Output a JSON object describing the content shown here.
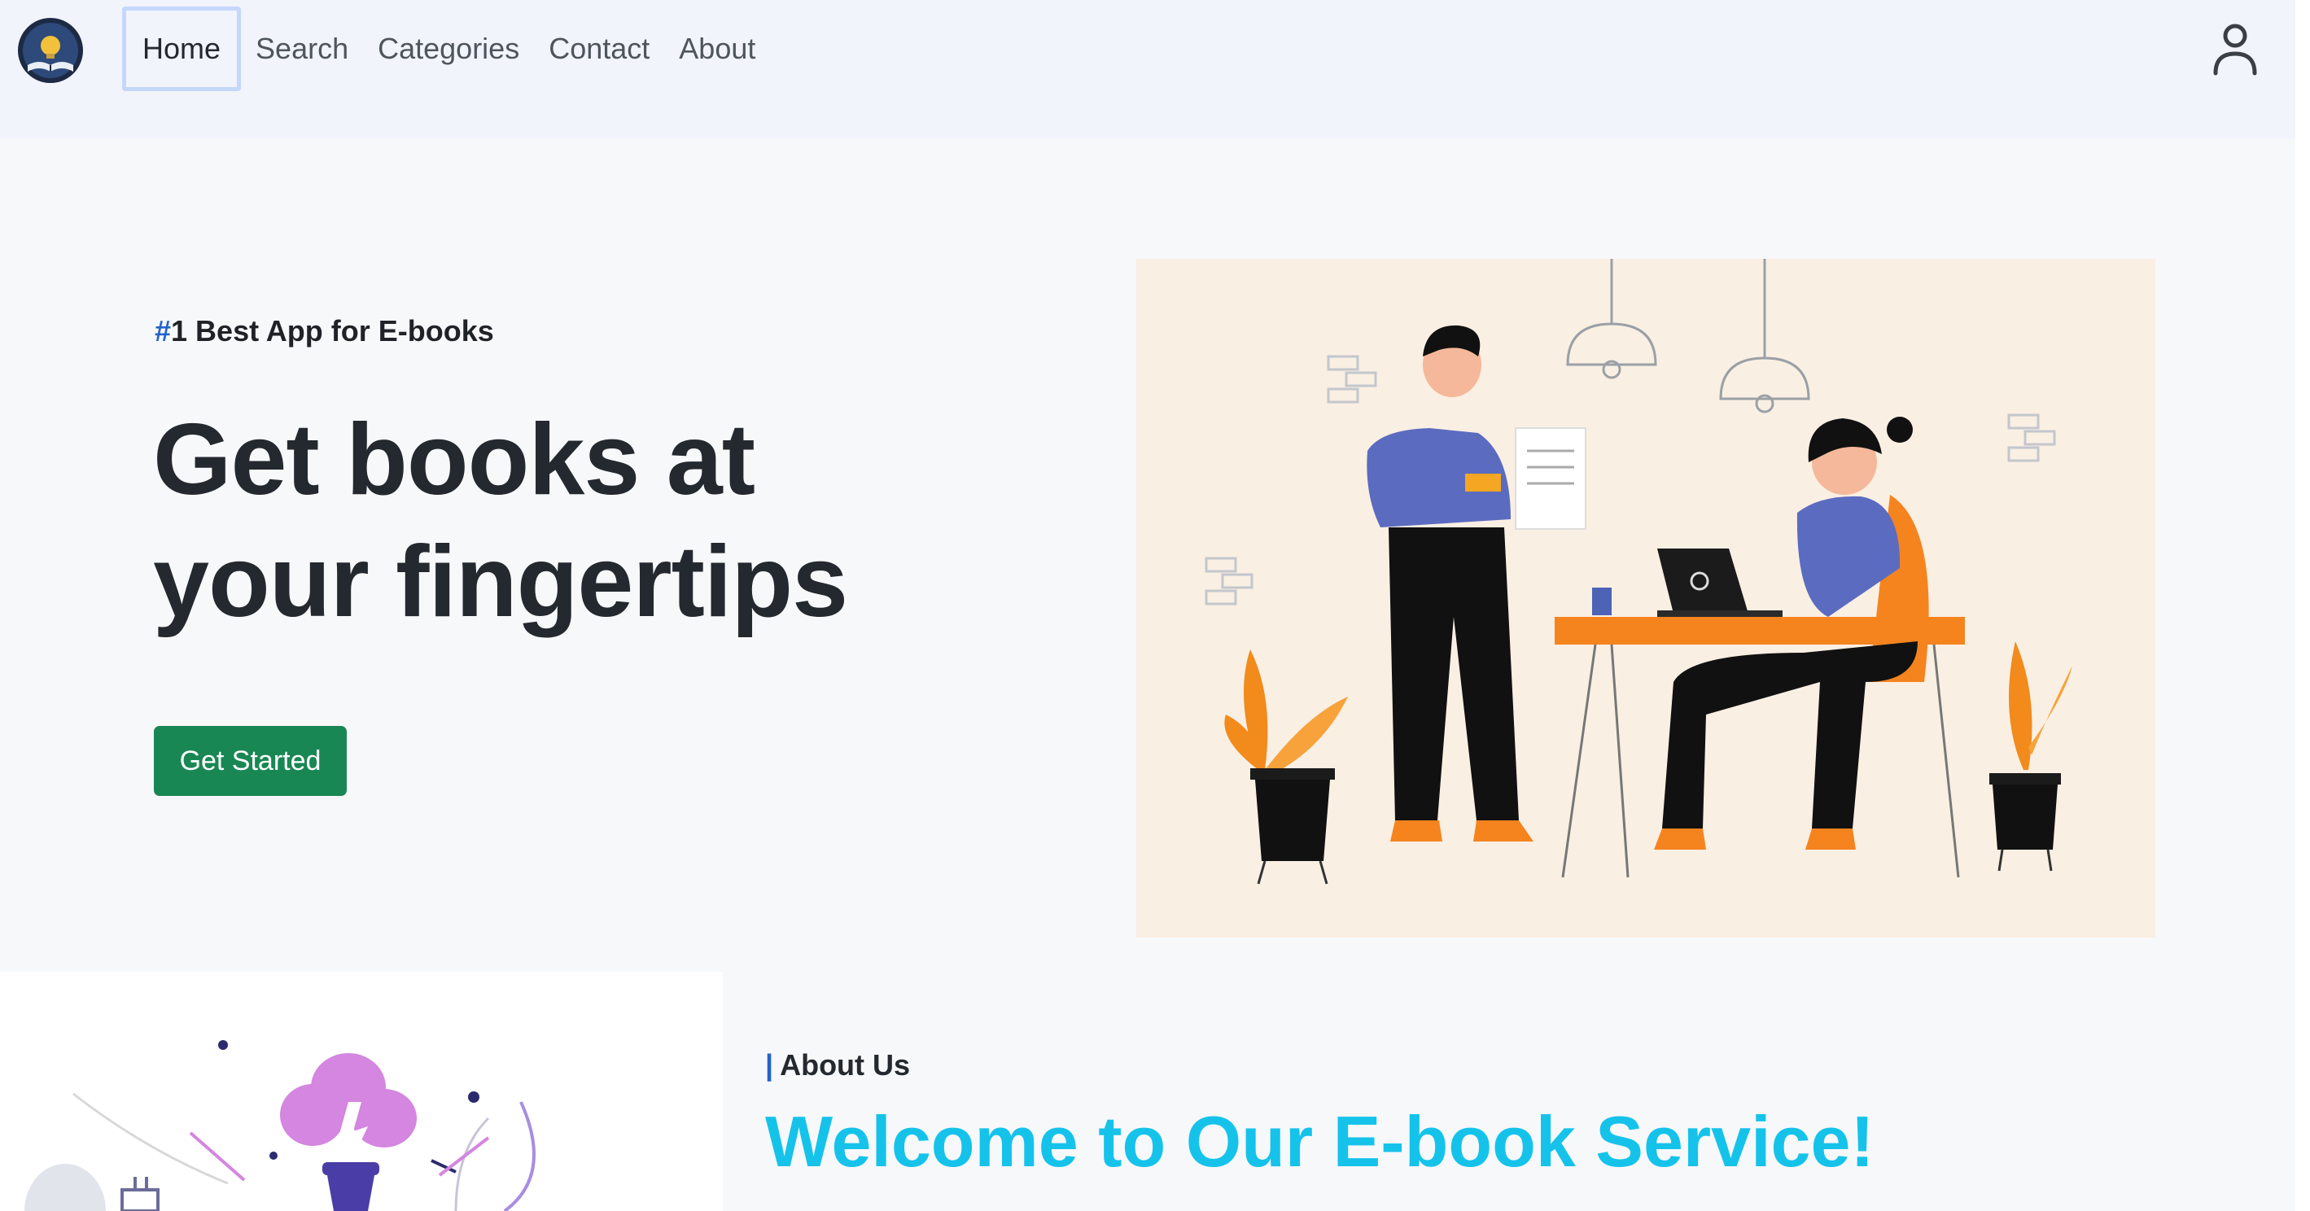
{
  "nav": {
    "logo_alt": "E-book logo",
    "links": [
      {
        "label": "Home",
        "active": true
      },
      {
        "label": "Search",
        "active": false
      },
      {
        "label": "Categories",
        "active": false
      },
      {
        "label": "Contact",
        "active": false
      },
      {
        "label": "About",
        "active": false
      }
    ],
    "user_icon": "user-icon"
  },
  "hero": {
    "tagline_hash": "#",
    "tagline_text": "1 Best App for E-books",
    "title_line1": "Get books at",
    "title_line2": "your fingertips",
    "cta_label": "Get Started",
    "illustration": "two-people-office-illustration"
  },
  "about": {
    "label_bar": "|",
    "label": "About Us",
    "heading": "Welcome to Our E-book Service!",
    "illustration": "lightbulb-cloud-illustration"
  },
  "colors": {
    "accent_green": "#198754",
    "accent_cyan": "#15c3ea",
    "accent_blue": "#2563c9",
    "nav_bg": "#f1f4fb",
    "page_bg": "#f7f8fa",
    "illustration_bg": "#faefe3"
  }
}
